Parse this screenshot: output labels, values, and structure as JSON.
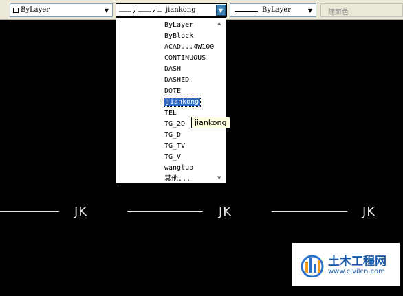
{
  "toolbar": {
    "layer_combo": {
      "value": "ByLayer"
    },
    "linetype_combo": {
      "value": "jiankong"
    },
    "lineweight_combo": {
      "value": "ByLayer"
    },
    "color_combo": {
      "value": "随颜色"
    }
  },
  "linetype_list": {
    "items": [
      {
        "label": "ByLayer",
        "pattern": "solid"
      },
      {
        "label": "ByBlock",
        "pattern": "solid"
      },
      {
        "label": "ACAD...4W100",
        "pattern": "dashdot"
      },
      {
        "label": "CONTINUOUS",
        "pattern": "solid"
      },
      {
        "label": "DASH",
        "pattern": "dash"
      },
      {
        "label": "DASHED",
        "pattern": "longdash"
      },
      {
        "label": "DOTE",
        "pattern": "dashdot"
      },
      {
        "label": "jiankong",
        "pattern": "jk",
        "selected": true
      },
      {
        "label": "TEL",
        "pattern": "tick"
      },
      {
        "label": "TG_2D",
        "pattern": "tg"
      },
      {
        "label": "TG_D",
        "pattern": "tg"
      },
      {
        "label": "TG_TV",
        "pattern": "tg"
      },
      {
        "label": "TG_V",
        "pattern": "tg"
      },
      {
        "label": "wangluo",
        "pattern": "gap"
      },
      {
        "label": "其他...",
        "pattern": "none"
      }
    ]
  },
  "tooltip": {
    "text": "jiankong"
  },
  "drawing": {
    "labels": [
      "JK",
      "JK",
      "JK"
    ]
  },
  "watermark": {
    "title": "土木工程网",
    "url": "www.civilcn.com"
  }
}
